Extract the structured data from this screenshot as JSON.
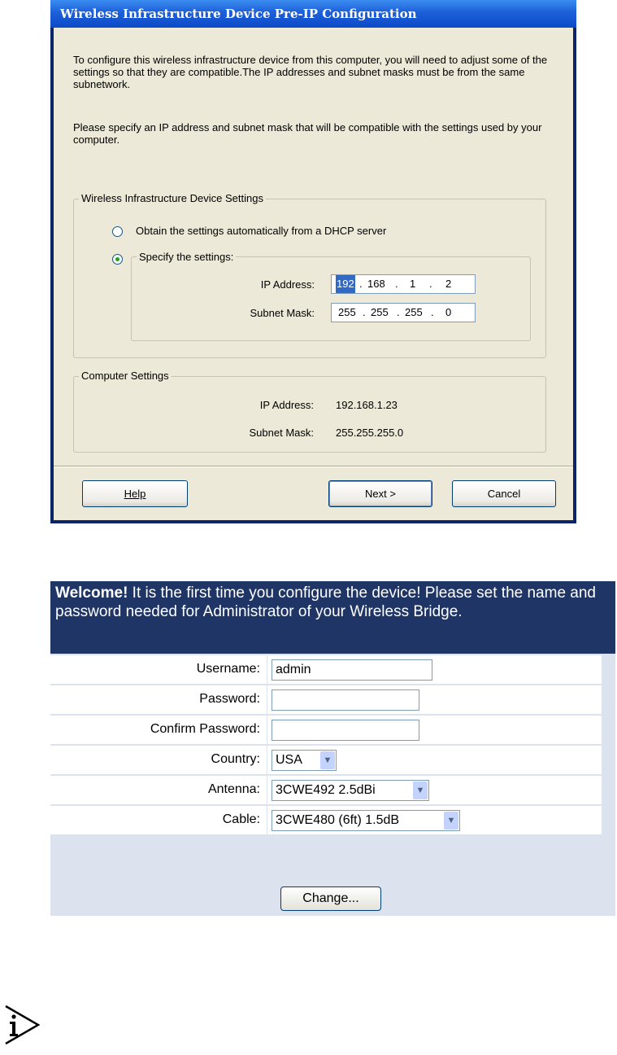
{
  "dialog": {
    "title": "Wireless Infrastructure Device Pre-IP Configuration",
    "intro_para1": "To configure this wireless infrastructure device from this computer, you will need to adjust some of the settings so that they are compatible.The IP addresses and subnet masks must be from the same subnetwork.",
    "intro_para2": "Please specify an IP address and subnet mask that will be compatible with the settings used by your computer.",
    "device_group": {
      "legend": "Wireless Infrastructure Device Settings",
      "option_dhcp": "Obtain the settings automatically from a DHCP server",
      "option_specify": "Specify the settings:",
      "selected": "specify",
      "ip_label": "IP Address:",
      "ip_octets": [
        "192",
        "168",
        "1",
        "2"
      ],
      "mask_label": "Subnet Mask:",
      "mask_octets": [
        "255",
        "255",
        "255",
        "0"
      ]
    },
    "computer_group": {
      "legend": "Computer Settings",
      "ip_label": "IP Address:",
      "ip_value": "192.168.1.23",
      "mask_label": "Subnet Mask:",
      "mask_value": "255.255.255.0"
    },
    "buttons": {
      "help": "Help",
      "next": "Next >",
      "cancel": "Cancel"
    }
  },
  "web_form": {
    "welcome_bold": "Welcome!",
    "welcome_text": " It is the first time you configure the device! Please set the name and password needed for Administrator of your Wireless Bridge.",
    "fields": {
      "username_label": "Username:",
      "username_value": "admin",
      "password_label": "Password:",
      "password_value": "",
      "confirm_label": "Confirm Password:",
      "confirm_value": "",
      "country_label": "Country:",
      "country_value": "USA",
      "antenna_label": "Antenna:",
      "antenna_value": "3CWE492 2.5dBi",
      "cable_label": "Cable:",
      "cable_value": "3CWE480 (6ft) 1.5dB"
    },
    "change_button": "Change..."
  },
  "colors": {
    "title_bar": "#1d5fd9",
    "dialog_bg": "#ece9d8",
    "welcome_bg": "#1e3566",
    "form_bg": "#dde3ee"
  },
  "icons": {
    "note": "info-note-icon",
    "dropdown": "chevron-down-icon"
  }
}
